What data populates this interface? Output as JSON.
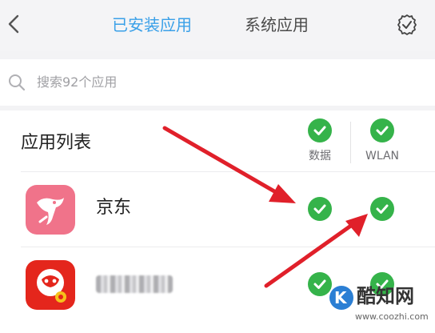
{
  "header": {
    "tabs": [
      {
        "label": "已安装应用",
        "active": true
      },
      {
        "label": "系统应用",
        "active": false
      }
    ],
    "back_icon": "chevron-left-icon",
    "settings_icon": "gear-check-icon"
  },
  "search": {
    "placeholder": "搜索92个应用",
    "icon": "search-icon"
  },
  "app_list": {
    "heading": "应用列表",
    "columns": [
      {
        "label": "数据",
        "checked": true
      },
      {
        "label": "WLAN",
        "checked": true
      }
    ],
    "apps": [
      {
        "name": "京东",
        "data_allowed": true,
        "wlan_allowed": true,
        "icon": "jd-dog-icon",
        "name_obscured": false
      },
      {
        "name": "",
        "data_allowed": true,
        "wlan_allowed": true,
        "icon": "jd-finance-icon",
        "name_obscured": true
      }
    ]
  },
  "watermark": {
    "logo_letter": "K",
    "title": "酷知网",
    "url": "www.coozhi.com"
  },
  "colors": {
    "accent": "#3aa0e8",
    "check_green": "#35b34a",
    "arrow_red": "#e0202a",
    "jd_pink": "#f0738a",
    "jd_red": "#e4261c"
  }
}
